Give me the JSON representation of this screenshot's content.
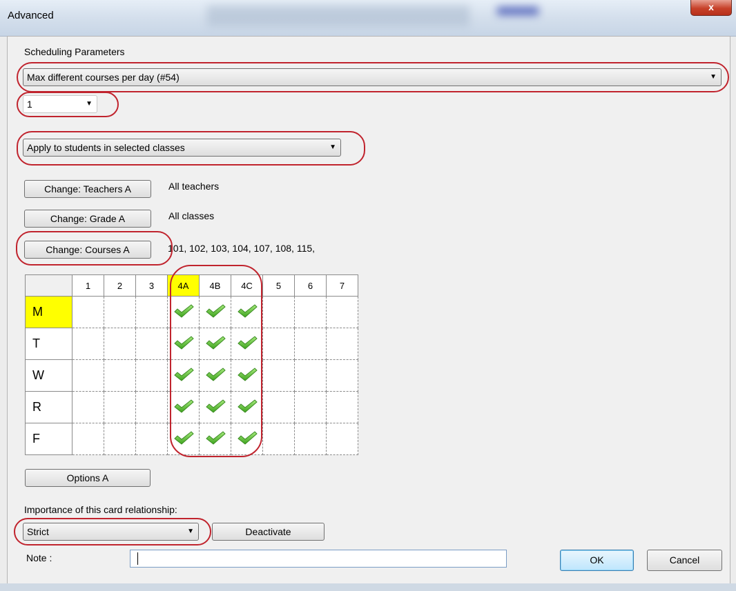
{
  "window": {
    "title": "Advanced",
    "close_glyph": "x"
  },
  "params": {
    "section_label": "Scheduling Parameters",
    "constraint_value": "Max different courses per day (#54)",
    "count_value": "1",
    "apply_value": "Apply to students in selected classes"
  },
  "changes": [
    {
      "button": "Change: Teachers A",
      "value": "All teachers"
    },
    {
      "button": "Change: Grade A",
      "value": "All classes"
    },
    {
      "button": "Change: Courses A",
      "value": "101, 102, 103, 104, 107, 108, 115,"
    }
  ],
  "grid": {
    "columns": [
      "1",
      "2",
      "3",
      "4A",
      "4B",
      "4C",
      "5",
      "6",
      "7"
    ],
    "highlighted_column": "4A",
    "highlighted_row": "M",
    "rows": [
      {
        "label": "M",
        "checked": [
          false,
          false,
          false,
          true,
          true,
          true,
          false,
          false,
          false
        ]
      },
      {
        "label": "T",
        "checked": [
          false,
          false,
          false,
          true,
          true,
          true,
          false,
          false,
          false
        ]
      },
      {
        "label": "W",
        "checked": [
          false,
          false,
          false,
          true,
          true,
          true,
          false,
          false,
          false
        ]
      },
      {
        "label": "R",
        "checked": [
          false,
          false,
          false,
          true,
          true,
          true,
          false,
          false,
          false
        ]
      },
      {
        "label": "F",
        "checked": [
          false,
          false,
          false,
          true,
          true,
          true,
          false,
          false,
          false
        ]
      }
    ],
    "check_icon": "green-checkmark-icon"
  },
  "options_button": "Options A",
  "importance": {
    "label": "Importance of this card relationship:",
    "value": "Strict",
    "deactivate": "Deactivate"
  },
  "note": {
    "label": "Note :",
    "value": ""
  },
  "footer": {
    "ok": "OK",
    "cancel": "Cancel"
  },
  "colors": {
    "highlight": "#ffff00",
    "annotation": "#c0232d",
    "check": "#5cc63a"
  }
}
